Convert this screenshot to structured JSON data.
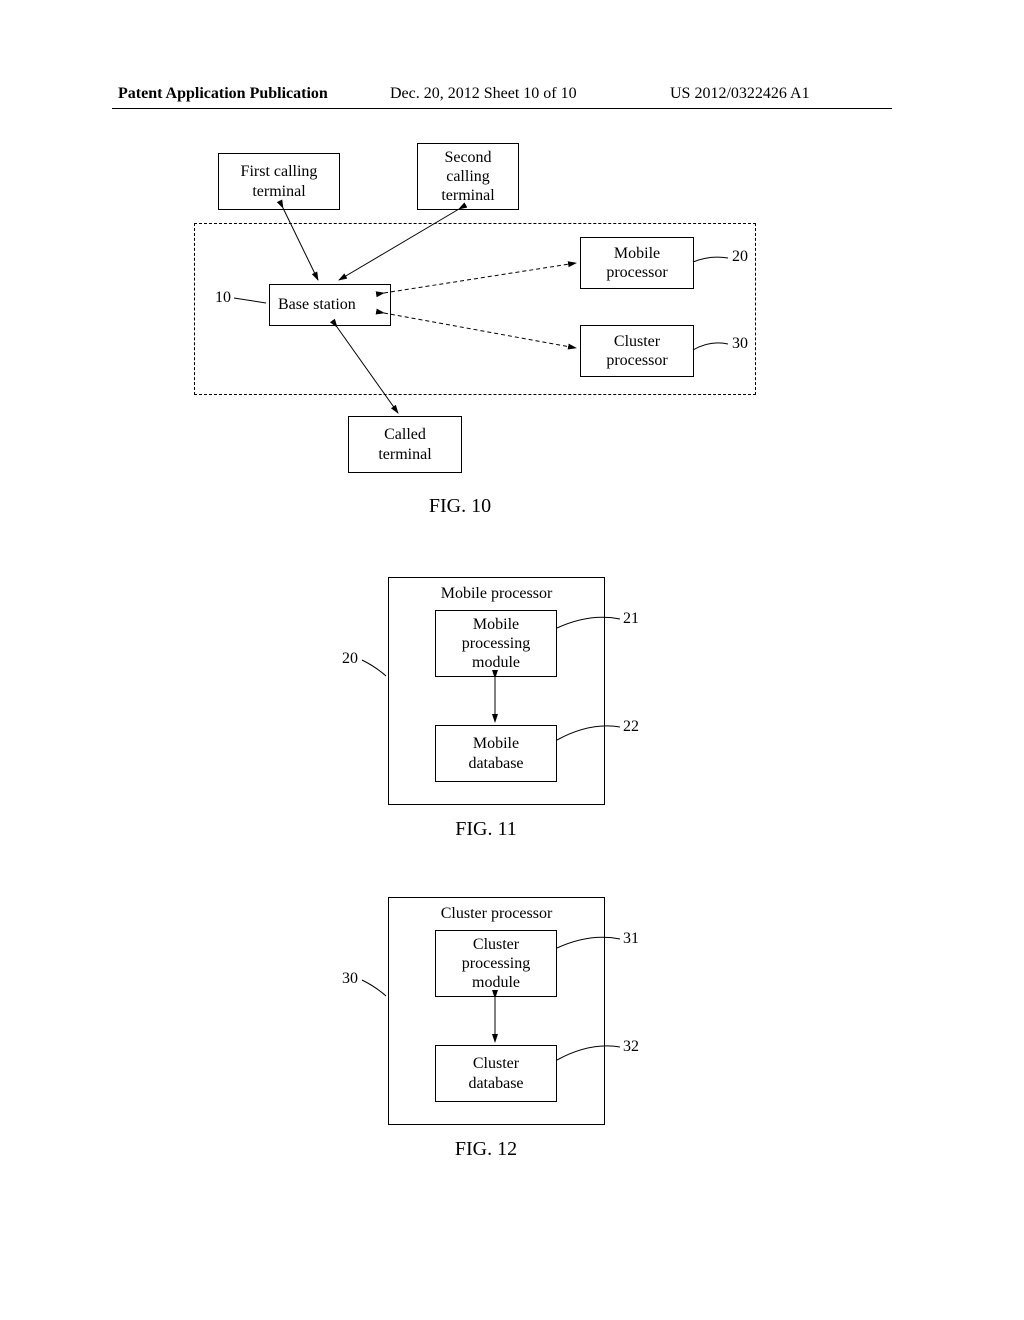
{
  "header": {
    "left": "Patent Application Publication",
    "mid": "Dec. 20, 2012   Sheet 10 of 10",
    "right": "US 2012/0322426 A1"
  },
  "fig10": {
    "caption": "FIG. 10",
    "boxes": {
      "first_calling": "First calling\nterminal",
      "second_calling": "Second\ncalling\nterminal",
      "base_station": "Base station",
      "mobile_proc": "Mobile\nprocessor",
      "cluster_proc": "Cluster\nprocessor",
      "called_terminal": "Called\nterminal"
    },
    "refs": {
      "base": "10",
      "mobile": "20",
      "cluster": "30"
    }
  },
  "fig11": {
    "caption": "FIG. 11",
    "outer_title": "Mobile processor",
    "inner_top": "Mobile\nprocessing\nmodule",
    "inner_bottom": "Mobile\ndatabase",
    "refs": {
      "outer": "20",
      "top": "21",
      "bottom": "22"
    }
  },
  "fig12": {
    "caption": "FIG. 12",
    "outer_title": "Cluster processor",
    "inner_top": "Cluster\nprocessing\nmodule",
    "inner_bottom": "Cluster\ndatabase",
    "refs": {
      "outer": "30",
      "top": "31",
      "bottom": "32"
    }
  }
}
